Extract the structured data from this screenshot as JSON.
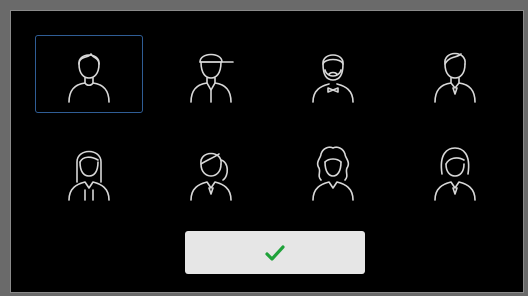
{
  "avatar_picker": {
    "selected_index": 0,
    "avatars": [
      {
        "icon": "man-short-hair-icon"
      },
      {
        "icon": "man-cap-icon"
      },
      {
        "icon": "man-beard-bowtie-icon"
      },
      {
        "icon": "man-side-part-icon"
      },
      {
        "icon": "woman-long-hair-icon"
      },
      {
        "icon": "woman-ponytail-icon"
      },
      {
        "icon": "woman-curly-hair-icon"
      },
      {
        "icon": "woman-bob-hair-icon"
      }
    ]
  },
  "confirm_button": {
    "icon": "checkmark-icon",
    "icon_color": "#1fa23a"
  },
  "colors": {
    "dialog_background": "#000000",
    "selection_border": "#2f5d95",
    "icon_stroke": "#d8d8d8",
    "button_background": "#e6e6e6"
  }
}
